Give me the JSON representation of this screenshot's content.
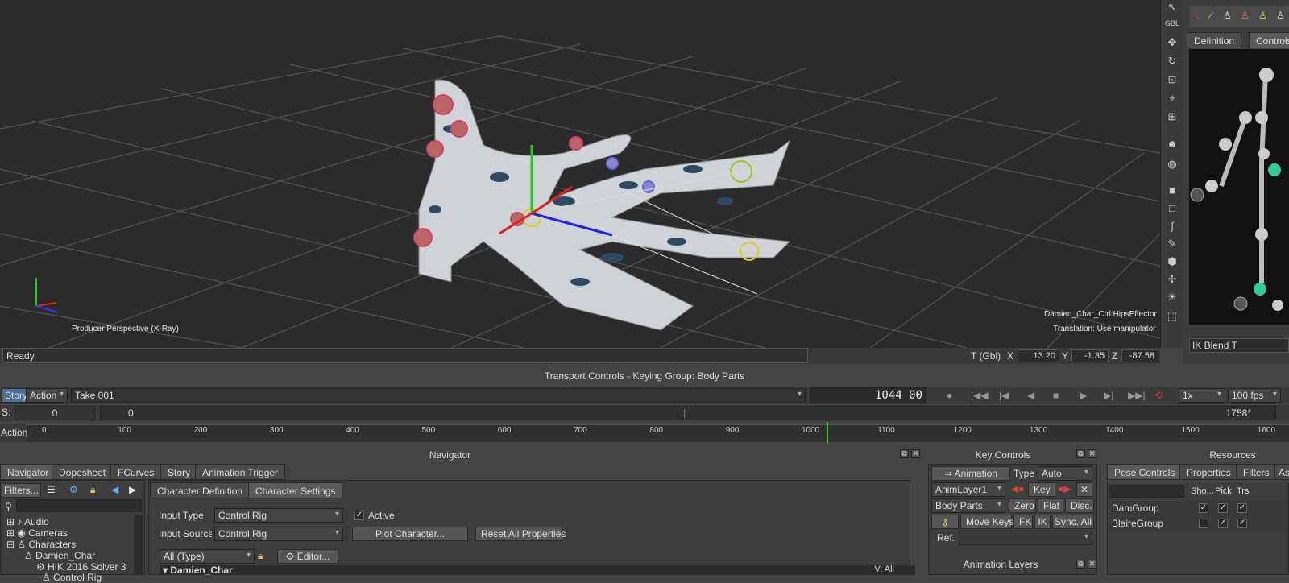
{
  "viewport": {
    "camera_label": "Producer Perspective (X-Ray)",
    "selection_label": "Damien_Char_Ctrl:HipsEffector",
    "mode_label": "Translation: Use manipulator"
  },
  "status": {
    "text": "Ready",
    "coord_mode": "T (Gbl)",
    "x_label": "X",
    "x_value": "13.20",
    "y_label": "Y",
    "y_value": "-1.35",
    "z_label": "Z",
    "z_value": "-87.58"
  },
  "right_toolbar": {
    "gbl_label": "GBL"
  },
  "character_panel": {
    "tabs": [
      "Definition",
      "Controls"
    ],
    "ik_blend_label": "IK Blend T"
  },
  "transport": {
    "title": "Transport Controls  -  Keying Group: Body Parts",
    "story_label": "Story",
    "action_label": "Action",
    "take": "Take 001",
    "frame_display": "1044  00",
    "speed": "1x",
    "fps": "100 fps",
    "start_label": "S:",
    "start_value": "0",
    "range_start": "0",
    "range_end": "1758*",
    "timeline_label": "Action",
    "ticks": [
      "0",
      "100",
      "200",
      "300",
      "400",
      "500",
      "600",
      "700",
      "800",
      "900",
      "1000",
      "1100",
      "1200",
      "1300",
      "1400",
      "1500",
      "1600"
    ],
    "current_frame": 1044
  },
  "navigator": {
    "title": "Navigator",
    "tabs": [
      "Navigator",
      "Dopesheet",
      "FCurves",
      "Story",
      "Animation Trigger"
    ],
    "filters_label": "Filters...",
    "tree": [
      "Audio",
      "Cameras",
      "Characters",
      "Damien_Char",
      "HIK 2016 Solver 3",
      "Control Rig"
    ],
    "subtabs": [
      "Character Definition",
      "Character Settings"
    ],
    "input_type_label": "Input Type",
    "input_type_value": "Control Rig",
    "active_label": "Active",
    "input_source_label": "Input Source",
    "input_source_value": "Control Rig",
    "plot_button": "Plot Character...",
    "reset_button": "Reset All Properties",
    "type_filter": "All (Type)",
    "editor_button": "Editor...",
    "section_title": "Damien_Char",
    "v_label": "V: All"
  },
  "key_controls": {
    "title": "Key Controls",
    "animation_label": "Animation",
    "type_label": "Type",
    "type_value": "Auto",
    "layer": "AnimLayer1",
    "key_button": "Key",
    "body_parts": "Body Parts",
    "zero": "Zero",
    "flat": "Flat",
    "disc": "Disc.",
    "move_keys": "Move Keys",
    "fk": "FK",
    "ik": "IK",
    "sync": "Sync. All",
    "ref_label": "Ref.",
    "layers_title": "Animation Layers"
  },
  "resources": {
    "title": "Resources",
    "tabs": [
      "Pose Controls",
      "Properties",
      "Filters",
      "As"
    ],
    "columns": [
      "Sho...",
      "Pick",
      "Trs"
    ],
    "groups": [
      {
        "name": "DamGroup",
        "show": true,
        "pick": true,
        "trs": true
      },
      {
        "name": "BlaireGroup",
        "show": false,
        "pick": true,
        "trs": true
      }
    ]
  }
}
